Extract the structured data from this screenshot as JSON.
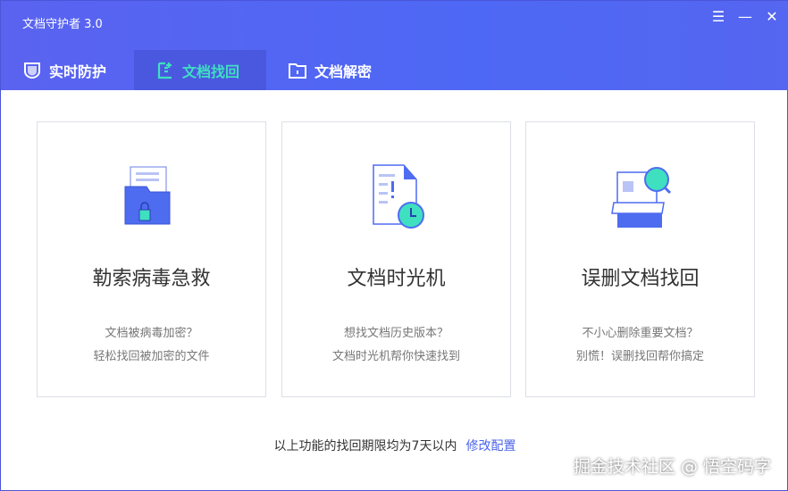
{
  "app": {
    "title": "文档守护者 3.0"
  },
  "window_controls": [
    "☰",
    "—",
    "✕"
  ],
  "tabs": [
    {
      "label": "实时防护"
    },
    {
      "label": "文档找回"
    },
    {
      "label": "文档解密"
    }
  ],
  "active_tab": 1,
  "cards": [
    {
      "title": "勒索病毒急救",
      "line1": "文档被病毒加密？",
      "line2": "轻松找回被加密的文件"
    },
    {
      "title": "文档时光机",
      "line1": "想找文档历史版本？",
      "line2": "文档时光机帮你快速找到"
    },
    {
      "title": "误删文档找回",
      "line1": "不小心删除重要文档？",
      "line2": "别慌！误删找回帮你搞定"
    }
  ],
  "footer": {
    "text": "以上功能的找回期限均为7天以内",
    "link": "修改配置"
  },
  "watermark": "掘金技术社区 @ 悟空码字",
  "colors": {
    "accent": "#4a63e8",
    "active_tab": "#3ee0c0",
    "header": "#5566f0"
  }
}
